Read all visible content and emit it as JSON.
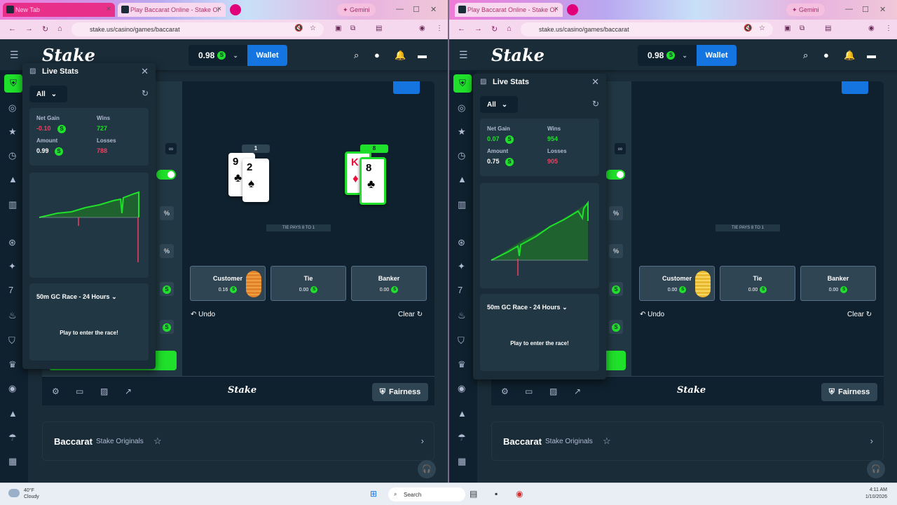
{
  "left": {
    "tabs": [
      {
        "title": "New Tab",
        "active": false
      },
      {
        "title": "Play Baccarat Online - Stake Or",
        "active": true
      }
    ],
    "gemini": "Gemini",
    "url": "stake.us/casino/games/baccarat",
    "balance": "0.98",
    "wallet": "Wallet",
    "cards": {
      "player": {
        "score": "1",
        "cards": [
          {
            "rank": "9",
            "suit": "♣"
          },
          {
            "rank": "2",
            "suit": "♠"
          }
        ]
      },
      "banker": {
        "score": "8",
        "cards": [
          {
            "rank": "K",
            "suit": "♦"
          },
          {
            "rank": "8",
            "suit": "♣"
          }
        ]
      }
    },
    "tie_banner": "TIE PAYS 8 TO 1",
    "bets": [
      {
        "name": "Customer",
        "amount": "0.16"
      },
      {
        "name": "Tie",
        "amount": "0.00"
      },
      {
        "name": "Banker",
        "amount": "0.00"
      }
    ],
    "undo": "Undo",
    "clear": "Clear",
    "fairness": "Fairness",
    "game_name": "Baccarat",
    "game_sub": "Stake Originals",
    "live_stats": {
      "title": "Live Stats",
      "filter": "All",
      "net_gain_label": "Net Gain",
      "net_gain": "-0.10",
      "wins_label": "Wins",
      "wins": "727",
      "amount_label": "Amount",
      "amount": "0.99",
      "losses_label": "Losses",
      "losses": "788",
      "race_title": "50m GC Race - 24 Hours",
      "race_msg": "Play to enter the race!"
    }
  },
  "right": {
    "tabs": [
      {
        "title": "Play Baccarat Online - Stake Or",
        "active": true
      }
    ],
    "gemini": "Gemini",
    "url": "stake.us/casino/games/baccarat",
    "balance": "0.98",
    "wallet": "Wallet",
    "tie_banner": "TIE PAYS 8 TO 1",
    "bets": [
      {
        "name": "Customer",
        "amount": "0.00"
      },
      {
        "name": "Tie",
        "amount": "0.00"
      },
      {
        "name": "Banker",
        "amount": "0.00"
      }
    ],
    "undo": "Undo",
    "clear": "Clear",
    "fairness": "Fairness",
    "game_name": "Baccarat",
    "game_sub": "Stake Originals",
    "live_stats": {
      "title": "Live Stats",
      "filter": "All",
      "net_gain_label": "Net Gain",
      "net_gain": "0.07",
      "wins_label": "Wins",
      "wins": "954",
      "amount_label": "Amount",
      "amount": "0.75",
      "losses_label": "Losses",
      "losses": "905",
      "race_title": "50m GC Race - 24 Hours",
      "race_msg": "Play to enter the race!"
    }
  },
  "taskbar": {
    "temp": "40°F",
    "condition": "Cloudy",
    "search": "Search",
    "time": "4:11 AM",
    "date": "1/10/2026"
  },
  "colors": {
    "accent_green": "#1fe02a",
    "wallet_blue": "#1475e1",
    "loss_red": "#ed4163",
    "bg": "#1a2c38"
  }
}
